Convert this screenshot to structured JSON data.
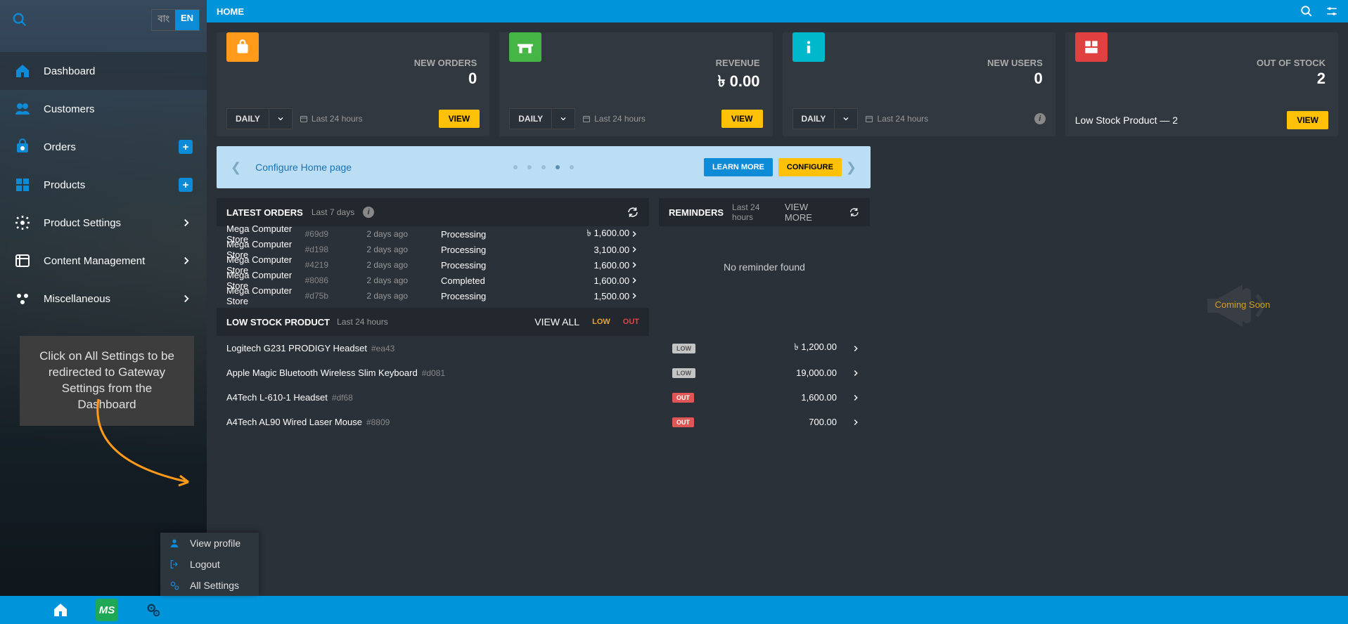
{
  "topbar": {
    "title": "HOME"
  },
  "lang": {
    "inactive": "বাং",
    "active": "EN"
  },
  "nav": [
    {
      "label": "Dashboard",
      "icon": "home",
      "active": true
    },
    {
      "label": "Customers",
      "icon": "users"
    },
    {
      "label": "Orders",
      "icon": "orders",
      "plus": true
    },
    {
      "label": "Products",
      "icon": "products",
      "plus": true
    },
    {
      "label": "Product Settings",
      "icon": "gear",
      "chev": true
    },
    {
      "label": "Content Management",
      "icon": "content",
      "chev": true
    },
    {
      "label": "Miscellaneous",
      "icon": "misc",
      "chev": true
    }
  ],
  "tooltip": "Click on All Settings to be redirected to Gateway Settings from the Dashboard",
  "popup": [
    {
      "label": "View profile",
      "icon": "user"
    },
    {
      "label": "Logout",
      "icon": "logout"
    },
    {
      "label": "All Settings",
      "icon": "gears"
    }
  ],
  "stats": {
    "cards": [
      {
        "label": "NEW ORDERS",
        "value": "0",
        "icon_bg": "#ff9a1a",
        "period": "DAILY",
        "range": "Last 24 hours",
        "view": "VIEW"
      },
      {
        "label": "REVENUE",
        "value": "৳  0.00",
        "icon_bg": "#45b545",
        "period": "DAILY",
        "range": "Last 24 hours",
        "view": "VIEW"
      },
      {
        "label": "NEW USERS",
        "value": "0",
        "icon_bg": "#00b8cc",
        "period": "DAILY",
        "range": "Last 24 hours",
        "info": true
      },
      {
        "label": "OUT OF STOCK",
        "value": "2",
        "icon_bg": "#e04040",
        "lowlink": "Low Stock Product — 2",
        "view": "VIEW"
      }
    ]
  },
  "banner": {
    "text": "Configure Home page",
    "learn": "LEARN MORE",
    "conf": "CONFIGURE"
  },
  "latest_orders": {
    "title": "LATEST ORDERS",
    "sub": "Last 7 days",
    "rows": [
      {
        "store": "Mega Computer Store",
        "id": "#69d9",
        "ago": "2 days ago",
        "status": "Processing",
        "amt": "৳ 1,600.00"
      },
      {
        "store": "Mega Computer Store",
        "id": "#d198",
        "ago": "2 days ago",
        "status": "Processing",
        "amt": "3,100.00"
      },
      {
        "store": "Mega Computer Store",
        "id": "#4219",
        "ago": "2 days ago",
        "status": "Processing",
        "amt": "1,600.00"
      },
      {
        "store": "Mega Computer Store",
        "id": "#8086",
        "ago": "2 days ago",
        "status": "Completed",
        "amt": "1,600.00"
      },
      {
        "store": "Mega Computer Store",
        "id": "#d75b",
        "ago": "2 days ago",
        "status": "Processing",
        "amt": "1,500.00"
      }
    ]
  },
  "low_stock": {
    "title": "LOW STOCK PRODUCT",
    "sub": "Last 24 hours",
    "viewall": "VIEW ALL",
    "low_tag": "LOW",
    "out_tag": "OUT",
    "rows": [
      {
        "name": "Logitech G231 PRODIGY Headset",
        "id": "#ea43",
        "badge": "LOW",
        "price": "৳ 1,200.00"
      },
      {
        "name": "Apple Magic Bluetooth Wireless Slim Keyboard",
        "id": "#d081",
        "badge": "LOW",
        "price": "19,000.00"
      },
      {
        "name": "A4Tech L-610-1 Headset",
        "id": "#df68",
        "badge": "OUT",
        "price": "1,600.00"
      },
      {
        "name": "A4Tech AL90 Wired Laser Mouse",
        "id": "#8809",
        "badge": "OUT",
        "price": "700.00"
      }
    ]
  },
  "reminders": {
    "title": "REMINDERS",
    "sub": "Last 24 hours",
    "viewmore": "VIEW MORE",
    "empty": "No reminder found"
  },
  "coming_soon": "Coming Soon",
  "ms_badge": "MS"
}
